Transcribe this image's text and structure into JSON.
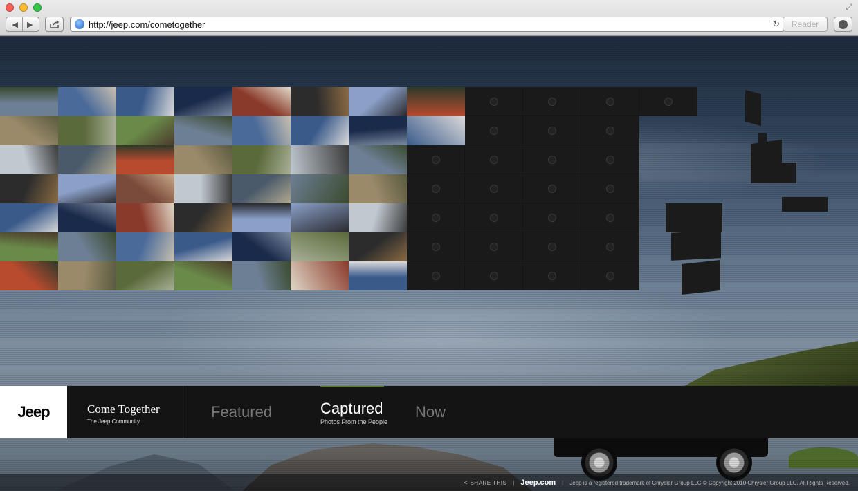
{
  "browser": {
    "url": "http://jeep.com/cometogether",
    "reader_label": "Reader"
  },
  "nav": {
    "logo": "Jeep",
    "brand_title": "Come Together",
    "brand_subtitle": "The Jeep Community",
    "items": [
      {
        "label": "Featured"
      },
      {
        "label": "Captured",
        "sub": "Photos From the People"
      },
      {
        "label": "Now"
      }
    ]
  },
  "footer": {
    "share": "SHARE THIS",
    "site_link": "Jeep.com",
    "legal": "Jeep is a registered trademark of Chrysler Group LLC © Copyright 2010 Chrysler Group LLC. All Rights Reserved."
  },
  "icons": {
    "back": "back-arrow-icon",
    "forward": "forward-arrow-icon",
    "share": "share-icon",
    "reload": "reload-icon",
    "download": "download-icon"
  },
  "colors": {
    "nav_background": "#141414",
    "active_accent": "#5a7a2a"
  }
}
